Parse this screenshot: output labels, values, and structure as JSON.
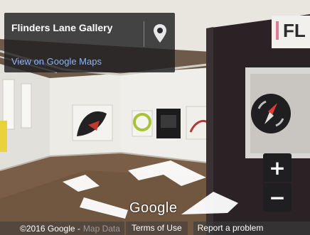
{
  "info_card": {
    "title": "Flinders Lane Gallery",
    "maps_link": "View on Google Maps",
    "pin_icon": "location-pin-icon"
  },
  "sign": {
    "text": "FL"
  },
  "controls": {
    "compass_icon": "compass-icon",
    "zoom_in_label": "+",
    "zoom_out_label": "−"
  },
  "branding": {
    "logo_text": "Google"
  },
  "footer": {
    "copyright": "©2016 Google -",
    "map_data": "Map Data",
    "terms": "Terms of Use",
    "report": "Report a problem"
  },
  "colors": {
    "link": "#8ab4f8",
    "panel_bg": "#1f1f22",
    "compass_red": "#e53935"
  }
}
